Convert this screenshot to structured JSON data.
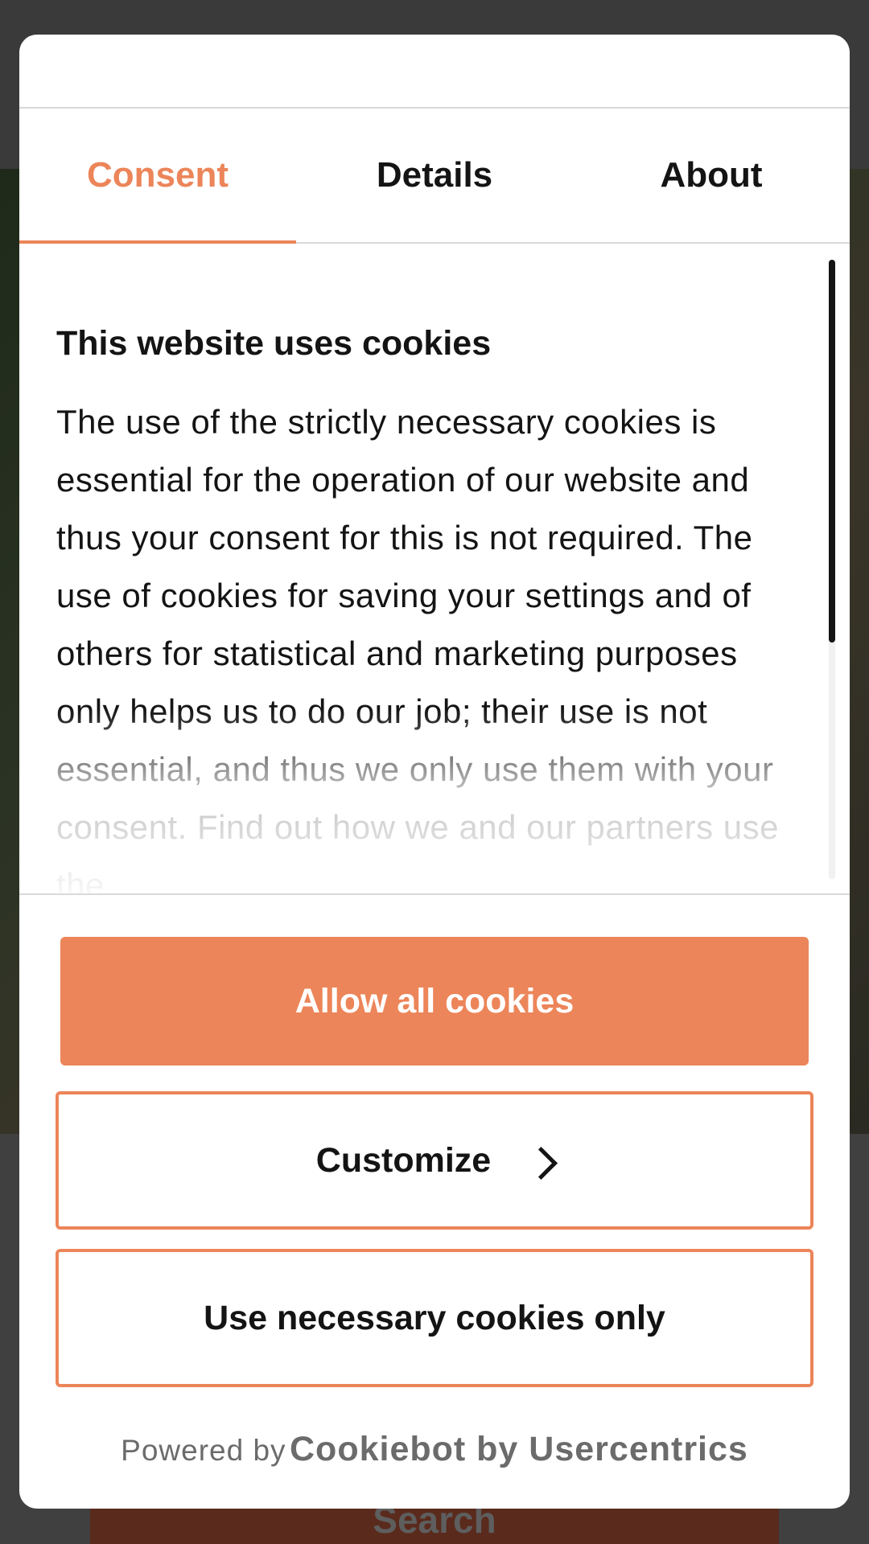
{
  "background": {
    "search_label": "Search"
  },
  "dialog": {
    "tabs": [
      {
        "label": "Consent",
        "active": true
      },
      {
        "label": "Details",
        "active": false
      },
      {
        "label": "About",
        "active": false
      }
    ],
    "title": "This website uses cookies",
    "body": "The use of the strictly necessary cookies is essential for the operation of our website and thus your consent for this is not required. The use of cookies for saving your settings and of others for statistical and marketing purposes only helps us to do our job; their use is not essential, and thus we only use them with your consent. Find out how we and our partners use the",
    "buttons": {
      "allow_all": "Allow all cookies",
      "customize": "Customize",
      "necessary_only": "Use necessary cookies only"
    },
    "powered_by_prefix": "Powered by",
    "powered_by_brand": "Cookiebot by Usercentrics"
  },
  "colors": {
    "accent": "#ec8559",
    "text": "#141414",
    "muted": "#6b6b6b"
  }
}
